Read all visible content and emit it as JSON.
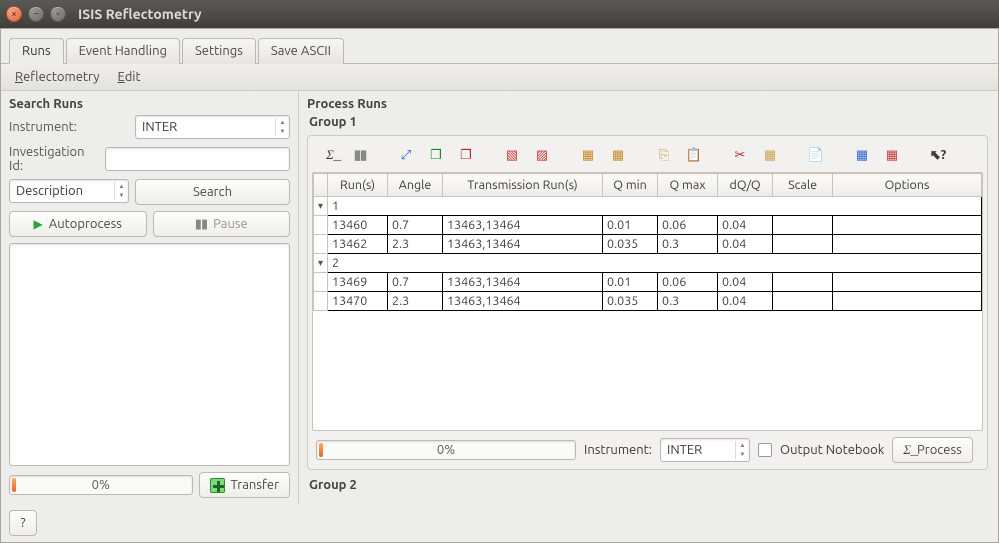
{
  "window": {
    "title": "ISIS Reflectometry"
  },
  "tabs": [
    {
      "label": "Runs",
      "active": true
    },
    {
      "label": "Event Handling",
      "active": false
    },
    {
      "label": "Settings",
      "active": false
    },
    {
      "label": "Save ASCII",
      "active": false
    }
  ],
  "menubar": {
    "reflectometry": "Reflectometry",
    "edit": "Edit"
  },
  "search": {
    "title": "Search Runs",
    "instrument_label": "Instrument:",
    "instrument_value": "INTER",
    "investigation_label": "Investigation Id:",
    "investigation_value": "",
    "mode": "Description",
    "search_button": "Search",
    "autoprocess_button": "Autoprocess",
    "pause_button": "Pause",
    "progress_text": "0%",
    "transfer_button": "Transfer"
  },
  "process": {
    "title": "Process Runs",
    "group1_label": "Group 1",
    "group2_label": "Group 2",
    "toolbar_icons": [
      "process-icon",
      "pause-icon",
      "expand-icon",
      "duplicate-green-icon",
      "duplicate-red-icon",
      "plot-icon",
      "plot-multi-icon",
      "insert-row-icon",
      "insert-group-icon",
      "copy-icon",
      "paste-icon",
      "cut-icon",
      "clear-icon",
      "notebook-icon",
      "date-icon",
      "date-red-icon",
      "whatsthis-icon"
    ],
    "toolbar_glyphs": {
      "process-icon": "Σ͟",
      "pause-icon": "▮▮",
      "expand-icon": "⤢",
      "duplicate-green-icon": "❐",
      "duplicate-red-icon": "❐",
      "plot-icon": "▧",
      "plot-multi-icon": "▧",
      "insert-row-icon": "▦",
      "insert-group-icon": "▦",
      "copy-icon": "⎘",
      "paste-icon": "📋",
      "cut-icon": "✂",
      "clear-icon": "🧹",
      "notebook-icon": "📄",
      "date-icon": "▦",
      "date-red-icon": "▦",
      "whatsthis-icon": "↖?"
    },
    "columns": [
      "Run(s)",
      "Angle",
      "Transmission Run(s)",
      "Q min",
      "Q max",
      "dQ/Q",
      "Scale",
      "Options"
    ],
    "groups": [
      {
        "id": "1",
        "rows": [
          {
            "runs": "13460",
            "angle": "0.7",
            "trans": "13463,13464",
            "qmin": "0.01",
            "qmax": "0.06",
            "dq": "0.04",
            "scale": "",
            "options": ""
          },
          {
            "runs": "13462",
            "angle": "2.3",
            "trans": "13463,13464",
            "qmin": "0.035",
            "qmax": "0.3",
            "dq": "0.04",
            "scale": "",
            "options": ""
          }
        ]
      },
      {
        "id": "2",
        "rows": [
          {
            "runs": "13469",
            "angle": "0.7",
            "trans": "13463,13464",
            "qmin": "0.01",
            "qmax": "0.06",
            "dq": "0.04",
            "scale": "",
            "options": ""
          },
          {
            "runs": "13470",
            "angle": "2.3",
            "trans": "13463,13464",
            "qmin": "0.035",
            "qmax": "0.3",
            "dq": "0.04",
            "scale": "",
            "options": ""
          }
        ]
      }
    ],
    "bottom": {
      "progress_text": "0%",
      "instrument_label": "Instrument:",
      "instrument_value": "INTER",
      "output_notebook_label": "Output Notebook",
      "process_button": "Process"
    }
  },
  "help_button": "?"
}
